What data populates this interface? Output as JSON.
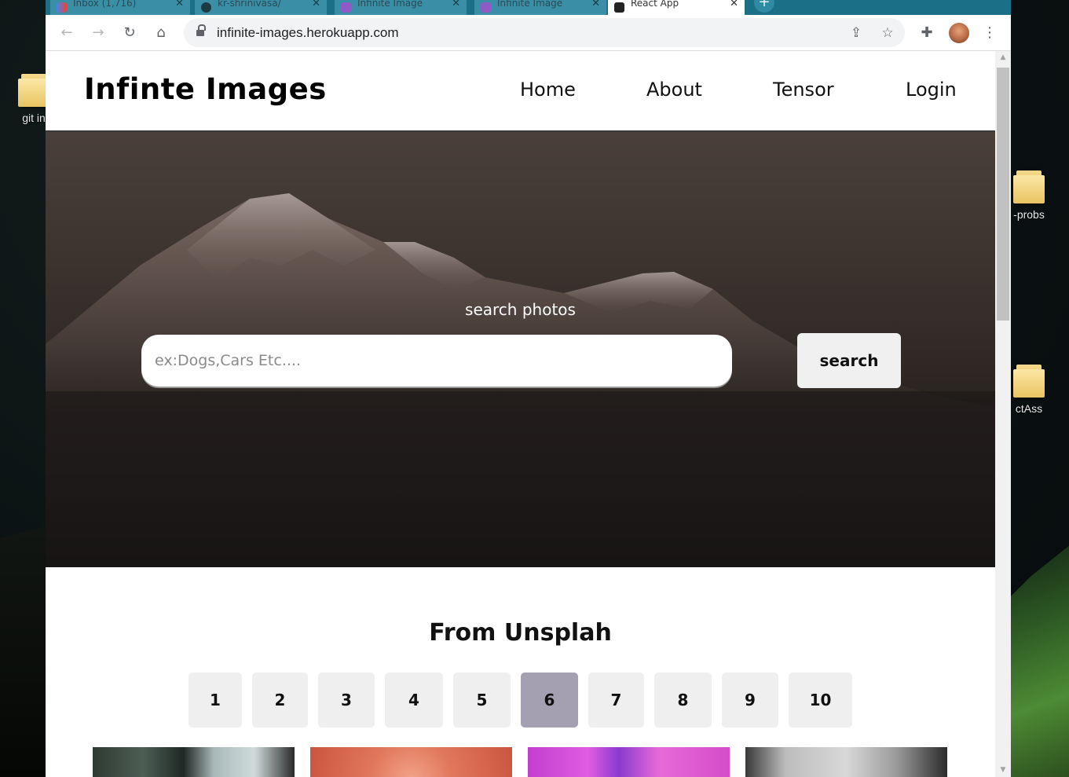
{
  "desktop": {
    "icons": [
      {
        "label": "git in"
      },
      {
        "label": "-probs"
      },
      {
        "label": "ctAss"
      }
    ]
  },
  "browser": {
    "tabs": [
      {
        "title": "Inbox (1,716)"
      },
      {
        "title": "kr-shrinivasa/"
      },
      {
        "title": "Infinite Image"
      },
      {
        "title": "Infinite Image"
      },
      {
        "title": "React App"
      }
    ],
    "new_tab_symbol": "+",
    "address_bar": {
      "url": "infinite-images.herokuapp.com"
    }
  },
  "page": {
    "brand": "Infinte Images",
    "nav": [
      "Home",
      "About",
      "Tensor",
      "Login"
    ],
    "hero": {
      "search_label": "search photos",
      "search_placeholder": "ex:Dogs,Cars Etc....",
      "search_button": "search"
    },
    "section_title": "From Unsplah",
    "pagination": {
      "pages": [
        "1",
        "2",
        "3",
        "4",
        "5",
        "6",
        "7",
        "8",
        "9",
        "10"
      ],
      "active_page": "6",
      "active_color": "#a4a0b1"
    }
  }
}
